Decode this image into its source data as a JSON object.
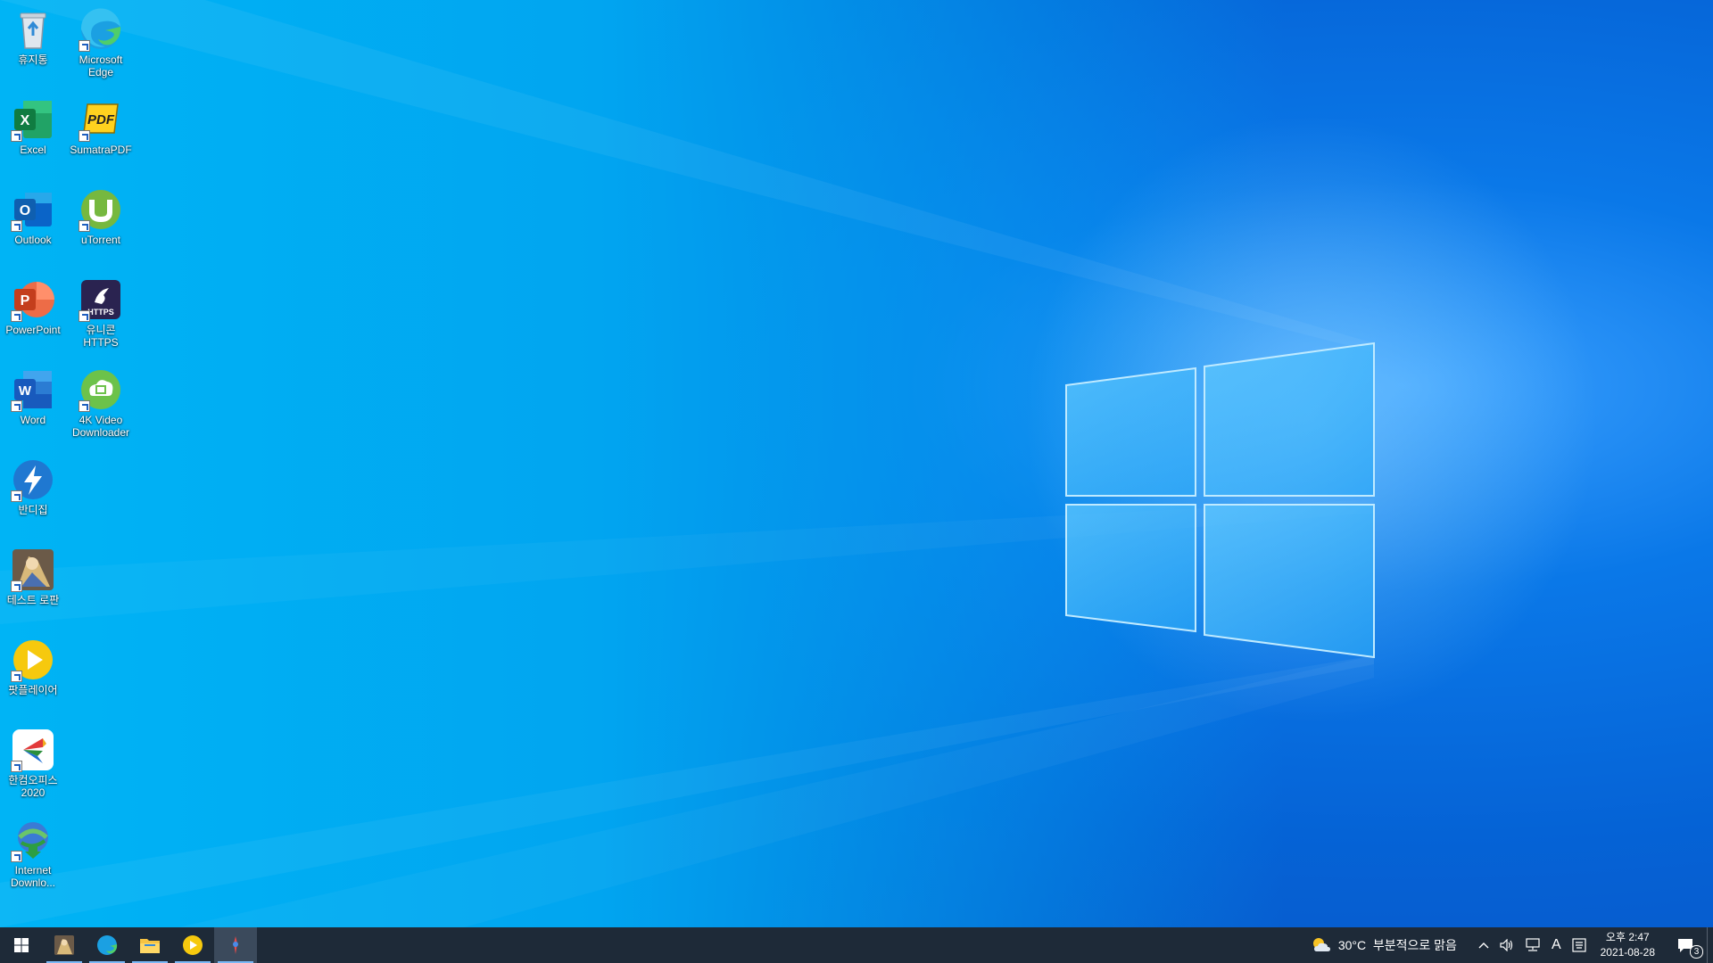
{
  "desktop": {
    "icons": [
      {
        "label": "휴지통",
        "icon": "recycle-bin-icon"
      },
      {
        "label": "Microsoft Edge",
        "icon": "edge-icon"
      },
      {
        "label": "Excel",
        "icon": "excel-icon"
      },
      {
        "label": "SumatraPDF",
        "icon": "sumatrapdf-icon"
      },
      {
        "label": "Outlook",
        "icon": "outlook-icon"
      },
      {
        "label": "uTorrent",
        "icon": "utorrent-icon"
      },
      {
        "label": "PowerPoint",
        "icon": "powerpoint-icon"
      },
      {
        "label": "유니콘 HTTPS",
        "icon": "unicorn-https-icon"
      },
      {
        "label": "Word",
        "icon": "word-icon"
      },
      {
        "label": "4K Video Downloader",
        "icon": "4k-video-downloader-icon"
      },
      {
        "label": "반디집",
        "icon": "bandizip-icon"
      },
      {
        "label": "테스트 로판",
        "icon": "game-icon"
      },
      {
        "label": "팟플레이어",
        "icon": "potplayer-icon"
      },
      {
        "label": "한컴오피스 2020",
        "icon": "hancom-office-icon"
      },
      {
        "label": "Internet Downlo...",
        "icon": "internet-download-manager-icon"
      }
    ]
  },
  "taskbar": {
    "buttons": [
      {
        "name": "start",
        "icon": "windows-start-icon"
      },
      {
        "name": "game",
        "icon": "game-icon"
      },
      {
        "name": "edge",
        "icon": "edge-icon"
      },
      {
        "name": "file-explorer",
        "icon": "folder-icon"
      },
      {
        "name": "potplayer",
        "icon": "potplayer-icon"
      },
      {
        "name": "app",
        "icon": "app-icon"
      }
    ],
    "weather": {
      "text": "30°C  부분적으로 맑음",
      "icon": "partly-sunny-icon"
    },
    "tray": {
      "ime": "A",
      "icons": [
        "chevron-up-icon",
        "speaker-icon",
        "network-icon",
        "ime-icon",
        "keyboard-icon"
      ]
    },
    "clock": {
      "time": "오후 2:47",
      "date": "2021-08-28"
    },
    "notifications": {
      "count": "3",
      "icon": "notification-icon"
    }
  },
  "colors": {
    "wallpaper": "#0a78e8",
    "taskbar": "#1e2a38"
  }
}
